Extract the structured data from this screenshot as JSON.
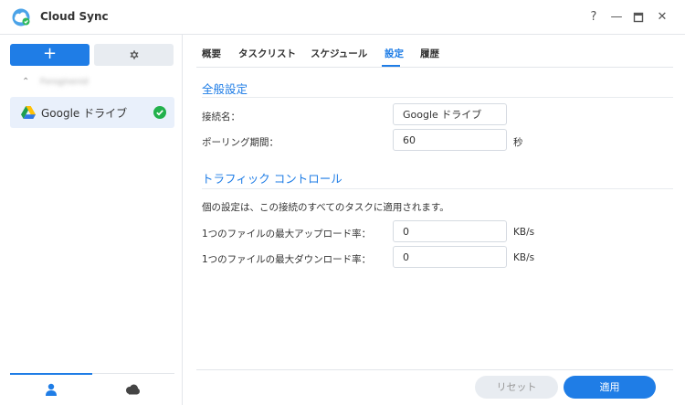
{
  "window": {
    "title": "Cloud Sync",
    "controls": {
      "help": "?",
      "minimize": "—",
      "maximize": "□",
      "close": "✕"
    }
  },
  "sidebar": {
    "add_label": "+",
    "group_name": "Foroginenid",
    "connections": [
      {
        "label": "Google ドライブ",
        "status": "connected"
      }
    ]
  },
  "tabs": [
    {
      "label": "概要"
    },
    {
      "label": "タスクリスト"
    },
    {
      "label": "スケジュール"
    },
    {
      "label": "設定",
      "active": true
    },
    {
      "label": "履歴"
    }
  ],
  "general": {
    "title": "全般設定",
    "connection_name_label": "接続名：",
    "connection_name_value": "Google ドライブ",
    "polling_label": "ポーリング期間：",
    "polling_value": "60",
    "polling_unit": "秒"
  },
  "traffic": {
    "title": "トラフィック コントロール",
    "description": "個の設定は、この接続のすべてのタスクに適用されます。",
    "upload_label": "1つのファイルの最大アップロード率：",
    "upload_value": "0",
    "upload_unit": "KB/s",
    "download_label": "1つのファイルの最大ダウンロード率：",
    "download_value": "0",
    "download_unit": "KB/s"
  },
  "footer": {
    "reset_label": "リセット",
    "apply_label": "適用"
  },
  "colors": {
    "accent": "#1f7de6",
    "success": "#22b14c"
  }
}
